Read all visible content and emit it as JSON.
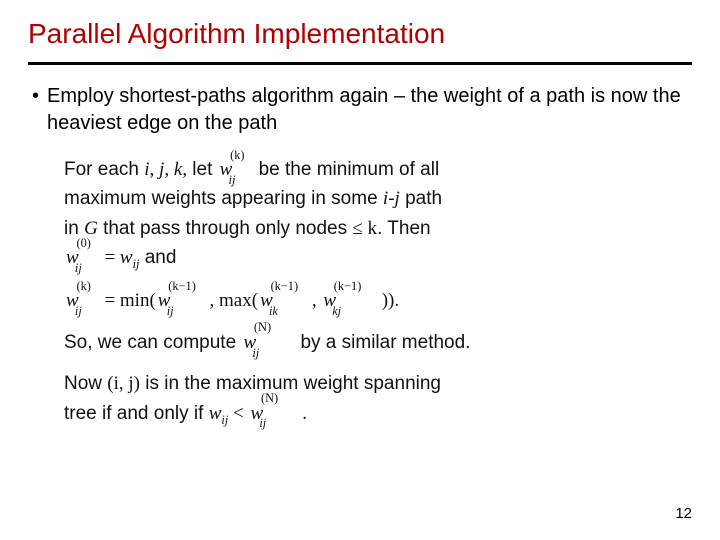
{
  "title": "Parallel Algorithm Implementation",
  "bullet": "Employ shortest-paths algorithm again – the weight of a path is now the heaviest edge on the path",
  "math": {
    "p1_a": "For each ",
    "p1_ijk": "i, j, k,",
    "p1_b": " let ",
    "p1_c": " be the minimum of all",
    "p2_a": "maximum weights appearing in some ",
    "p2_ij": "i‑j",
    "p2_b": " path",
    "p3_a": "in ",
    "p3_G": "G",
    "p3_b": " that pass through only nodes ",
    "p3_leq": "≤ k",
    "p3_c": ". Then",
    "p4_eq": " = ",
    "p4_and": " and",
    "p5_eq": " = min(",
    "p5_comma": ", max(",
    "p5_comma2": ", ",
    "p5_end": ")).",
    "p6_a": "So, we can compute ",
    "p6_b": " by a similar method.",
    "p7_a": "Now ",
    "p7_ij": "(i, j)",
    "p7_b": " is in the maximum weight spanning",
    "p8_a": "tree if and only if ",
    "p8_lt": " < ",
    "p8_end": "."
  },
  "w": {
    "base": "w",
    "sup_k": "(k)",
    "sup_0": "(0)",
    "sup_km1": "(k−1)",
    "sup_N": "(N)",
    "sub_ij": "ij",
    "sub_ik": "ik",
    "sub_kj": "kj"
  },
  "page_number": "12"
}
